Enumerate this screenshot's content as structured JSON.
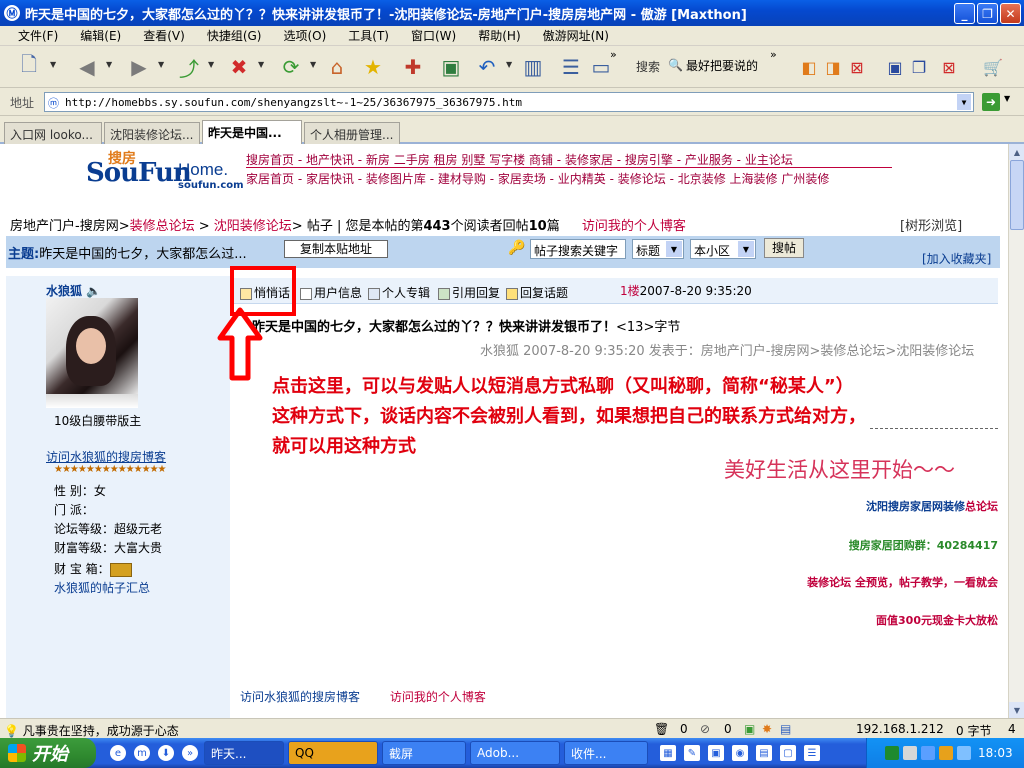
{
  "window": {
    "title": "昨天是中国的七夕，大家都怎么过的丫？？快来讲讲发银币了！-沈阳装修论坛-房地产门户-搜房房地产网 - 傲游 [Maxthon]",
    "app_icon": "Ⓜ"
  },
  "menu": [
    "文件(F)",
    "编辑(E)",
    "查看(V)",
    "快捷组(G)",
    "选项(O)",
    "工具(T)",
    "窗口(W)",
    "帮助(H)",
    "傲游网址(N)"
  ],
  "toolbar": {
    "search_label": "搜索",
    "search_value": "最好把要说的"
  },
  "address": {
    "label": "地址",
    "url": "http://homebbs.sy.soufun.com/shenyangzslt~-1~25/36367975_36367975.htm"
  },
  "tabs": [
    {
      "label": "入口网 looko..."
    },
    {
      "label": "沈阳装修论坛..."
    },
    {
      "label": "昨天是中国..."
    },
    {
      "label": "个人相册管理..."
    }
  ],
  "site": {
    "logo_main": "SouFun",
    "logo_home": "Home.",
    "logo_domain": "soufun.com",
    "logo_cn": "搜房",
    "nav1": "搜房首页 - 地产快讯 - 新房 二手房 租房 别墅 写字楼 商铺 - 装修家居 - 搜房引擎 - 产业服务 - 业主论坛",
    "nav2": "家居首页 - 家居快讯 - 装修图片库 - 建材导购 - 家居卖场 - 业内精英 - 装修论坛 - 北京装修 上海装修 广州装修"
  },
  "breadcrumb": {
    "p1": "房地产门户-搜房网>",
    "p2": "装修总论坛",
    "p3": " > ",
    "p4": "沈阳装修论坛",
    "p5": "> 帖子 | 您是本帖的第",
    "reads": "443",
    "p6": "个阅读者回帖",
    "replies": "10",
    "p7": "篇",
    "blog": "访问我的个人博客",
    "tree": "[树形浏览]"
  },
  "topic": {
    "label": "主题:",
    "title": "昨天是中国的七夕，大家都怎么过...",
    "copy_button": "复制本贴地址",
    "search_field": "帖子搜索关键字",
    "select1": "标题",
    "select2": "本小区",
    "search_button": "搜帖",
    "add_fav": "[加入收藏夹]"
  },
  "poster": {
    "name": "水狼狐",
    "sound_icon": "🔈",
    "rank_title": "10级白腰带版主",
    "blog_link": "访问水狼狐的搜房博客",
    "stars": "★★★★★★★★★★★★★★",
    "gender": "性 别：女",
    "sect": "门 派：",
    "forum_level": "论坛等级：超级元老",
    "wealth_level": "财富等级：大富大贵",
    "treasure": "财 宝 箱：",
    "posts_link": "水狼狐的帖子汇总"
  },
  "post_actions": [
    "悄悄话",
    "用户信息",
    "个人专辑",
    "引用回复",
    "回复话题"
  ],
  "post": {
    "floor": "1楼",
    "datetime": "2007-8-20 9:35:20",
    "title": "昨天是中国的七夕，大家都怎么过的丫？？快来讲讲发银币了！",
    "size": "<13>字节",
    "meta": "水狼狐 2007-8-20 9:35:20 发表于：房地产门户-搜房网>装修总论坛>沈阳装修论坛",
    "slogan": "美好生活从这里开始～～"
  },
  "annotation": {
    "line1": "点击这里，可以与发贴人以短消息方式私聊（又叫秘聊，简称“秘某人”）",
    "line2": "这种方式下，谈话内容不会被别人看到，如果想把自己的联系方式给对方，",
    "line3": "就可以用这种方式"
  },
  "ads": {
    "a1": "沈阳搜房家居网装修",
    "a1b": "总论坛",
    "a2": "搜房家居团购群：40284417",
    "a3": "装修论坛 全预览，帖子教学，一看就会",
    "a4": "面值300元现金卡大放松"
  },
  "bottom_links": {
    "l1": "访问水狼狐的搜房博客",
    "l2": "访问我的个人博客"
  },
  "status": {
    "text": "凡事贵在坚持，成功源于心态",
    "count0": "0",
    "count1": "0",
    "ip": "192.168.1.212",
    "bytes": "0 字节",
    "num": "4"
  },
  "taskbar": {
    "start": "开始",
    "tasks": [
      "昨天...",
      "QQ",
      "截屏",
      "Adob...",
      "收件..."
    ],
    "clock": "18:03"
  },
  "colors": {
    "accent": "#0549cf",
    "brand_red": "#c0003c",
    "annot_red": "#e0000e"
  }
}
